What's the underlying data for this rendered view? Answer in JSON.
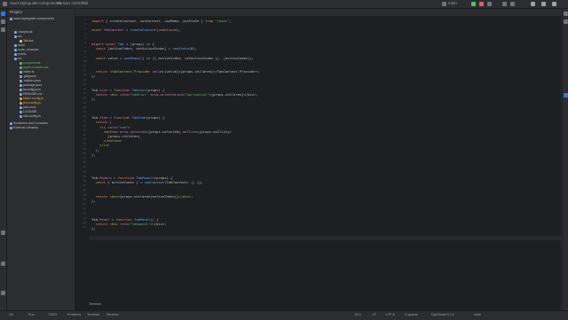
{
  "titlebar": {
    "app_name": "react-styleguide-components",
    "branch": "Version control",
    "file_label": "Tab",
    "run_config": "main"
  },
  "project_panel": {
    "title": "Project",
    "root": "react-styleguide-components",
    "items": [
      {
        "label": ".storybook",
        "color": "#bcbec4"
      },
      {
        "label": "src",
        "color": "#bcbec4"
      },
      {
        "label": "Tab.tsx",
        "color": "#e0c46c"
      },
      {
        "label": "build",
        "color": "#bcbec4"
      },
      {
        "label": "node_modules",
        "color": "#bcbec4"
      },
      {
        "label": "public",
        "color": "#bcbec4"
      },
      {
        "label": "src",
        "color": "#bcbec4"
      },
      {
        "label": "components",
        "color": "#6aab73"
      },
      {
        "label": "styles.module.css",
        "color": "#6aab73"
      },
      {
        "label": "index.ts",
        "color": "#bcbec4"
      },
      {
        "label": ".gitignore",
        "color": "#bcbec4"
      },
      {
        "label": ".eslintrc.json",
        "color": "#bcbec4"
      },
      {
        "label": "package.json",
        "color": "#bcbec4"
      },
      {
        "label": "tsconfig.json",
        "color": "#bcbec4"
      },
      {
        "label": "README.md",
        "color": "#bcbec4"
      },
      {
        "label": "babel.config.js",
        "color": "#d9a343"
      },
      {
        "label": "jest.config.js",
        "color": "#d9a343"
      },
      {
        "label": "yarn.lock",
        "color": "#bcbec4"
      },
      {
        "label": "LICENSE",
        "color": "#bcbec4"
      },
      {
        "label": "vite.config.ts",
        "color": "#bcbec4"
      },
      {
        "label": "Scratches and Consoles",
        "color": "#bcbec4"
      },
      {
        "label": "External Libraries",
        "color": "#bcbec4"
      }
    ]
  },
  "editor": {
    "tab_label": "Tab.tsx",
    "lines": [
      [
        {
          "t": "import ",
          "c": "k"
        },
        {
          "t": "{ ",
          "c": "p"
        },
        {
          "t": "createContext",
          "c": "p"
        },
        {
          "t": ", useContext, useMemo, useState } ",
          "c": "p"
        },
        {
          "t": "from ",
          "c": "k"
        },
        {
          "t": "'react'",
          "c": "s"
        },
        {
          "t": ";",
          "c": "p"
        }
      ],
      [],
      [
        {
          "t": "const ",
          "c": "k"
        },
        {
          "t": "TabContext ",
          "c": "v"
        },
        {
          "t": "= ",
          "c": "p"
        },
        {
          "t": "createContext",
          "c": "f"
        },
        {
          "t": "(",
          "c": "p"
        },
        {
          "t": "undefined",
          "c": "k"
        },
        {
          "t": ");",
          "c": "p"
        }
      ],
      [],
      [],
      [
        {
          "t": "export ",
          "c": "k"
        },
        {
          "t": "const ",
          "c": "k"
        },
        {
          "t": "Tab ",
          "c": "f"
        },
        {
          "t": "= ",
          "c": "p"
        },
        {
          "t": "(props) ",
          "c": "p"
        },
        {
          "t": "=> {",
          "c": "p"
        }
      ],
      [
        {
          "t": "  const ",
          "c": "k"
        },
        {
          "t": "[activeIndex, setActiveIndex] ",
          "c": "p"
        },
        {
          "t": "= ",
          "c": "p"
        },
        {
          "t": "useState",
          "c": "f"
        },
        {
          "t": "(0);",
          "c": "p"
        }
      ],
      [],
      [
        {
          "t": "  const ",
          "c": "k"
        },
        {
          "t": "value ",
          "c": "p"
        },
        {
          "t": "= ",
          "c": "p"
        },
        {
          "t": "useMemo",
          "c": "f"
        },
        {
          "t": "(() => ({ activeIndex, setActiveIndex }), [activeIndex]);",
          "c": "p"
        }
      ],
      [],
      [],
      [
        {
          "t": "  return ",
          "c": "k"
        },
        {
          "t": "<TabContext.Provider ",
          "c": "a"
        },
        {
          "t": "value",
          "c": "v"
        },
        {
          "t": "={value}>{props.children}</TabContext.Provider>;",
          "c": "p"
        }
      ],
      [
        {
          "t": "};",
          "c": "p"
        }
      ],
      [],
      [],
      [
        {
          "t": "Tab",
          "c": "p"
        },
        {
          "t": ".List ",
          "c": "v"
        },
        {
          "t": "= ",
          "c": "p"
        },
        {
          "t": "function ",
          "c": "k"
        },
        {
          "t": "TabList",
          "c": "f"
        },
        {
          "t": "(props) {",
          "c": "p"
        }
      ],
      [
        {
          "t": "  return ",
          "c": "k"
        },
        {
          "t": "<div ",
          "c": "a"
        },
        {
          "t": "role",
          "c": "v"
        },
        {
          "t": "=",
          "c": "p"
        },
        {
          "t": "\"tablist\" ",
          "c": "s"
        },
        {
          "t": "aria-orientation",
          "c": "v"
        },
        {
          "t": "=",
          "c": "p"
        },
        {
          "t": "\"horizontal\"",
          "c": "s"
        },
        {
          "t": ">{props.children}</div>;",
          "c": "p"
        }
      ],
      [
        {
          "t": "};",
          "c": "p"
        }
      ],
      [],
      [],
      [],
      [
        {
          "t": "Tab",
          "c": "p"
        },
        {
          "t": ".Item ",
          "c": "v"
        },
        {
          "t": "= ",
          "c": "p"
        },
        {
          "t": "function ",
          "c": "k"
        },
        {
          "t": "TabItem",
          "c": "f"
        },
        {
          "t": "(props) {",
          "c": "p"
        }
      ],
      [
        {
          "t": "  return ",
          "c": "k"
        },
        {
          "t": "(",
          "c": "p"
        }
      ],
      [
        {
          "t": "    <li ",
          "c": "a"
        },
        {
          "t": "role",
          "c": "v"
        },
        {
          "t": "=",
          "c": "p"
        },
        {
          "t": "\"tab\"",
          "c": "s"
        },
        {
          "t": ">",
          "c": "p"
        }
      ],
      [
        {
          "t": "      <button ",
          "c": "a"
        },
        {
          "t": "aria-selected",
          "c": "v"
        },
        {
          "t": "=",
          "c": "p"
        },
        {
          "t": "{props.selected}",
          "c": "p"
        },
        {
          "t": " onClick",
          "c": "v"
        },
        {
          "t": "={props.onClick}>",
          "c": "p"
        }
      ],
      [
        {
          "t": "        {props.children}",
          "c": "p"
        }
      ],
      [
        {
          "t": "      </button>",
          "c": "a"
        }
      ],
      [
        {
          "t": "    </li>",
          "c": "a"
        }
      ],
      [
        {
          "t": "  );",
          "c": "p"
        }
      ],
      [
        {
          "t": "};",
          "c": "p"
        }
      ],
      [],
      [],
      [],
      [],
      [
        {
          "t": "Tab",
          "c": "p"
        },
        {
          "t": ".Panels ",
          "c": "v"
        },
        {
          "t": "= ",
          "c": "p"
        },
        {
          "t": "function ",
          "c": "k"
        },
        {
          "t": "TabPanels",
          "c": "f"
        },
        {
          "t": "(props) {",
          "c": "p"
        }
      ],
      [
        {
          "t": "  const ",
          "c": "k"
        },
        {
          "t": "{ activeIndex } ",
          "c": "p"
        },
        {
          "t": "= ",
          "c": "p"
        },
        {
          "t": "useContext",
          "c": "f"
        },
        {
          "t": "(TabContext) ",
          "c": "p"
        },
        {
          "t": "|| ",
          "c": "p"
        },
        {
          "t": "{};",
          "c": "p"
        }
      ],
      [],
      [],
      [
        {
          "t": "  return ",
          "c": "k"
        },
        {
          "t": "<div>",
          "c": "a"
        },
        {
          "t": "{props.children[activeIndex]}",
          "c": "p"
        },
        {
          "t": "</div>",
          "c": "a"
        },
        {
          "t": ";",
          "c": "p"
        }
      ],
      [
        {
          "t": "};",
          "c": "p"
        }
      ],
      [],
      [],
      [],
      [
        {
          "t": "Tab",
          "c": "p"
        },
        {
          "t": ".Panel ",
          "c": "v"
        },
        {
          "t": "= ",
          "c": "p"
        },
        {
          "t": "function ",
          "c": "k"
        },
        {
          "t": "TabPanel",
          "c": "f"
        },
        {
          "t": "() {",
          "c": "p"
        }
      ],
      [
        {
          "t": "  return ",
          "c": "k"
        },
        {
          "t": "<div ",
          "c": "a"
        },
        {
          "t": "role",
          "c": "v"
        },
        {
          "t": "=",
          "c": "p"
        },
        {
          "t": "\"tabpanel\"",
          "c": "s"
        },
        {
          "t": "></div>;",
          "c": "p"
        }
      ],
      [
        {
          "t": "};",
          "c": "p"
        }
      ]
    ]
  },
  "statusbar": {
    "items": [
      "Git",
      "Run",
      "TODO",
      "Problems",
      "Terminal",
      "Services"
    ],
    "right": [
      "62:1",
      "LF",
      "UTF-8",
      "2 spaces",
      "TypeScript 5.2.2",
      "main"
    ]
  },
  "bottom_tab": "Terminal"
}
